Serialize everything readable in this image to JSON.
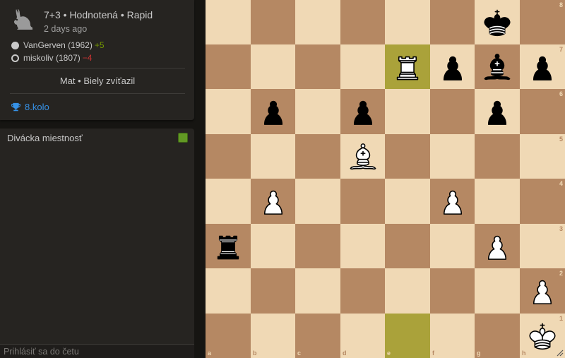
{
  "game": {
    "setup": "7+3 • Hodnotená • Rapid",
    "date": "2 days ago",
    "white": {
      "name": "VanGerven (1962)",
      "diff": "+5"
    },
    "black": {
      "name": "miskoliv (1807)",
      "diff": "−4"
    },
    "status": "Mat • Biely zvíťazil",
    "tournament": "8.kolo"
  },
  "chat": {
    "title": "Divácka miestnosť",
    "input_placeholder": "Prihlásiť sa do četu"
  },
  "board": {
    "files": [
      "a",
      "b",
      "c",
      "d",
      "e",
      "f",
      "g",
      "h"
    ],
    "ranks": [
      "8",
      "7",
      "6",
      "5",
      "4",
      "3",
      "2",
      "1"
    ],
    "highlight": [
      "e7",
      "e1"
    ],
    "pieces": {
      "g8": "bk",
      "e7": "wr",
      "f7": "bp",
      "g7": "bb",
      "h7": "bp",
      "b6": "bp",
      "d6": "bp",
      "g6": "bp",
      "d5": "wb",
      "b4": "wp",
      "f4": "wp",
      "a3": "br",
      "g3": "wp",
      "h2": "wp",
      "h1": "wk"
    }
  }
}
